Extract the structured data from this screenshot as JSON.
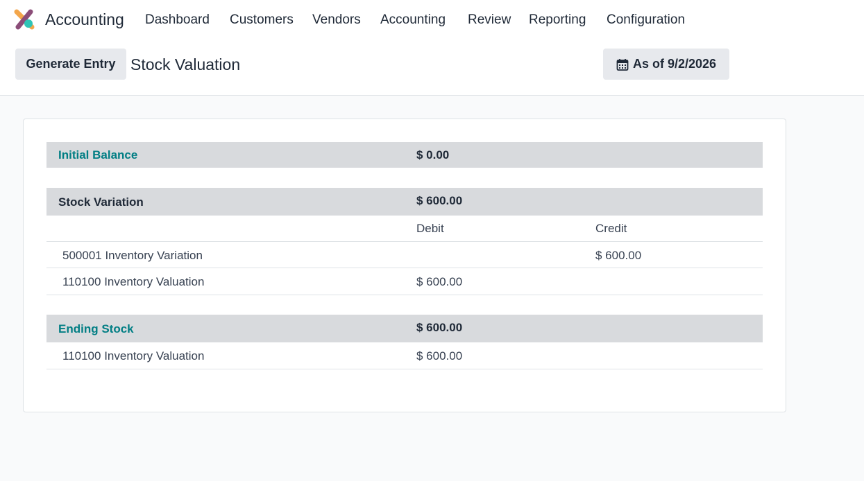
{
  "app": {
    "name": "Accounting"
  },
  "menu": [
    {
      "label": "Dashboard"
    },
    {
      "label": "Customers"
    },
    {
      "label": "Vendors"
    },
    {
      "label": "Accounting"
    },
    {
      "label": "Review"
    },
    {
      "label": "Reporting"
    },
    {
      "label": "Configuration"
    }
  ],
  "controls": {
    "generate_label": "Generate Entry",
    "page_title": "Stock Valuation",
    "date_label": "As of 9/2/2026",
    "date_icon": "calendar-icon"
  },
  "report": {
    "initial": {
      "label": "Initial Balance",
      "value": "$ 0.00"
    },
    "variation": {
      "label": "Stock Variation",
      "value": "$ 600.00",
      "debit_header": "Debit",
      "credit_header": "Credit",
      "lines": [
        {
          "account": "500001 Inventory Variation",
          "debit": "",
          "credit": "$ 600.00"
        },
        {
          "account": "110100 Inventory Valuation",
          "debit": "$ 600.00",
          "credit": ""
        }
      ]
    },
    "ending": {
      "label": "Ending Stock",
      "value": "$ 600.00",
      "lines": [
        {
          "account": "110100 Inventory Valuation",
          "debit": "$ 600.00"
        }
      ]
    }
  },
  "colors": {
    "accent_teal": "#017e84",
    "section_bg": "#d8dadd",
    "button_bg": "#e7e9ed"
  }
}
